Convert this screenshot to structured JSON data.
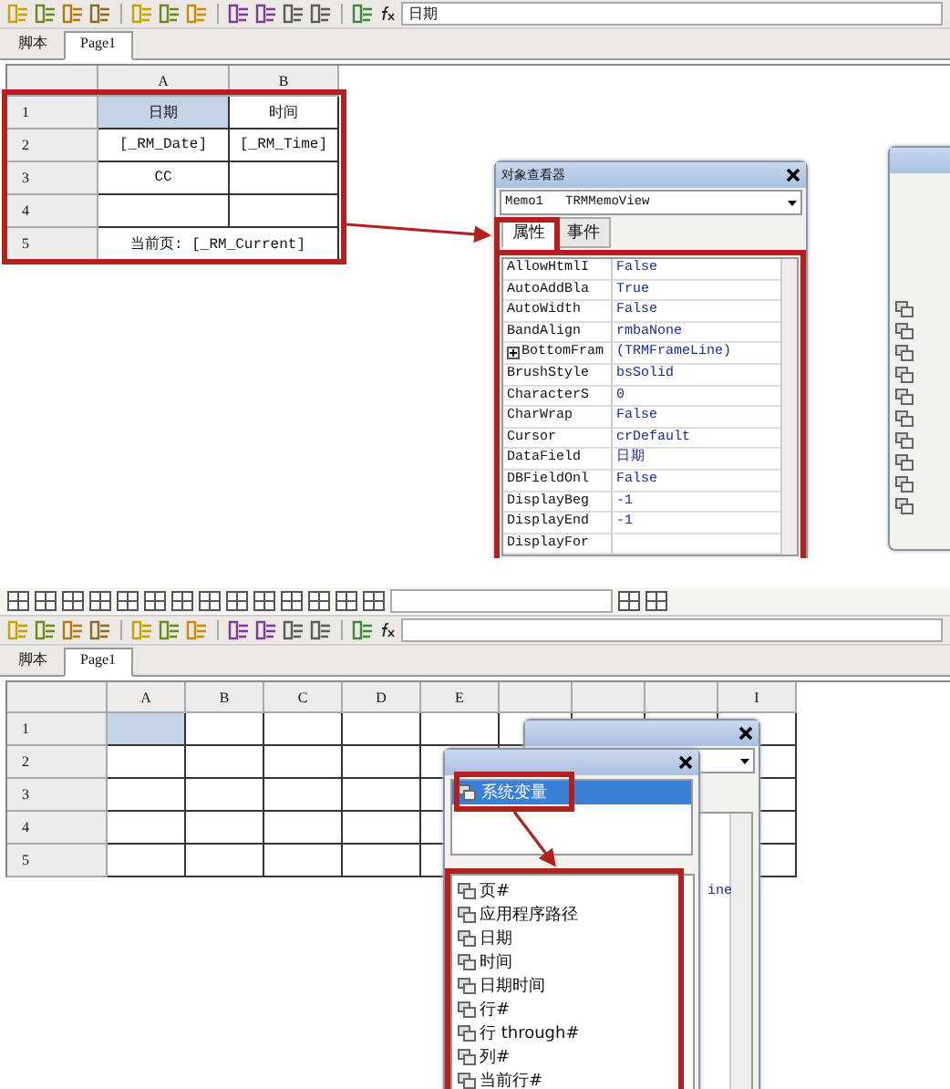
{
  "top": {
    "formula_bar": {
      "value": "日期"
    },
    "tabs": [
      {
        "label": "脚本",
        "selected": false
      },
      {
        "label": "Page1",
        "selected": true
      }
    ],
    "grid": {
      "columns": [
        "A",
        "B"
      ],
      "rows": [
        {
          "header": "1",
          "cells": [
            {
              "text": "日期",
              "selected": true
            },
            {
              "text": "时间",
              "selected": false
            }
          ]
        },
        {
          "header": "2",
          "cells": [
            {
              "text": "[_RM_Date]",
              "selected": false
            },
            {
              "text": "[_RM_Time]",
              "selected": false
            }
          ]
        },
        {
          "header": "3",
          "cells": [
            {
              "text": "CC",
              "selected": false
            },
            {
              "text": "",
              "selected": false
            }
          ]
        },
        {
          "header": "4",
          "cells": [
            {
              "text": "",
              "selected": false
            },
            {
              "text": "",
              "selected": false
            }
          ]
        },
        {
          "header": "5",
          "cells": [
            {
              "text": "当前页: [_RM_Current]",
              "selected": false,
              "merged": true
            }
          ]
        }
      ]
    },
    "inspector": {
      "title": "对象查看器",
      "object": "Memo1",
      "class": "TRMMemoView",
      "tabs": [
        {
          "label": "属性",
          "selected": true
        },
        {
          "label": "事件",
          "selected": false
        }
      ],
      "properties": [
        {
          "name": "AllowHtmlI",
          "value": "False",
          "expandable": false
        },
        {
          "name": "AutoAddBla",
          "value": "True",
          "expandable": false
        },
        {
          "name": "AutoWidth",
          "value": "False",
          "expandable": false
        },
        {
          "name": "BandAlign",
          "value": "rmbaNone",
          "expandable": false
        },
        {
          "name": "BottomFram",
          "value": "(TRMFrameLine)",
          "expandable": true
        },
        {
          "name": "BrushStyle",
          "value": "bsSolid",
          "expandable": false
        },
        {
          "name": "CharacterS",
          "value": "0",
          "expandable": false
        },
        {
          "name": "CharWrap",
          "value": "False",
          "expandable": false
        },
        {
          "name": "Cursor",
          "value": "crDefault",
          "expandable": false
        },
        {
          "name": "DataField",
          "value": "日期",
          "expandable": false
        },
        {
          "name": "DBFieldOnl",
          "value": "False",
          "expandable": false
        },
        {
          "name": "DisplayBeg",
          "value": "-1",
          "expandable": false
        },
        {
          "name": "DisplayEnd",
          "value": "-1",
          "expandable": false
        },
        {
          "name": "DisplayFor",
          "expandable": false
        }
      ]
    }
  },
  "bottom": {
    "tabs": [
      {
        "label": "脚本",
        "selected": false
      },
      {
        "label": "Page1",
        "selected": true
      }
    ],
    "grid": {
      "columns": [
        {
          "kind": "heading",
          "label": "A"
        },
        {
          "kind": "heading",
          "label": "B"
        },
        {
          "kind": "heading",
          "label": "C"
        },
        {
          "kind": "heading",
          "label": "D"
        },
        {
          "kind": "heading",
          "label": "E"
        },
        {
          "kind": "covered"
        },
        {
          "kind": "covered"
        },
        {
          "kind": "covered"
        },
        {
          "kind": "heading",
          "label": "I"
        }
      ],
      "rows": [
        {
          "header": "1",
          "selected": true
        },
        {
          "header": "2",
          "selected": false
        },
        {
          "header": "3",
          "selected": false
        },
        {
          "header": "4",
          "selected": false
        },
        {
          "header": "5",
          "selected": false
        }
      ]
    },
    "inspector": {
      "value_fragment": "ine"
    },
    "popup": {
      "tree": [
        {
          "label": "系统变量",
          "selected": true
        }
      ],
      "variables": [
        "页#",
        "应用程序路径",
        "日期",
        "时间",
        "日期时间",
        "行#",
        "行 through#",
        "列#",
        "当前行#"
      ]
    }
  }
}
